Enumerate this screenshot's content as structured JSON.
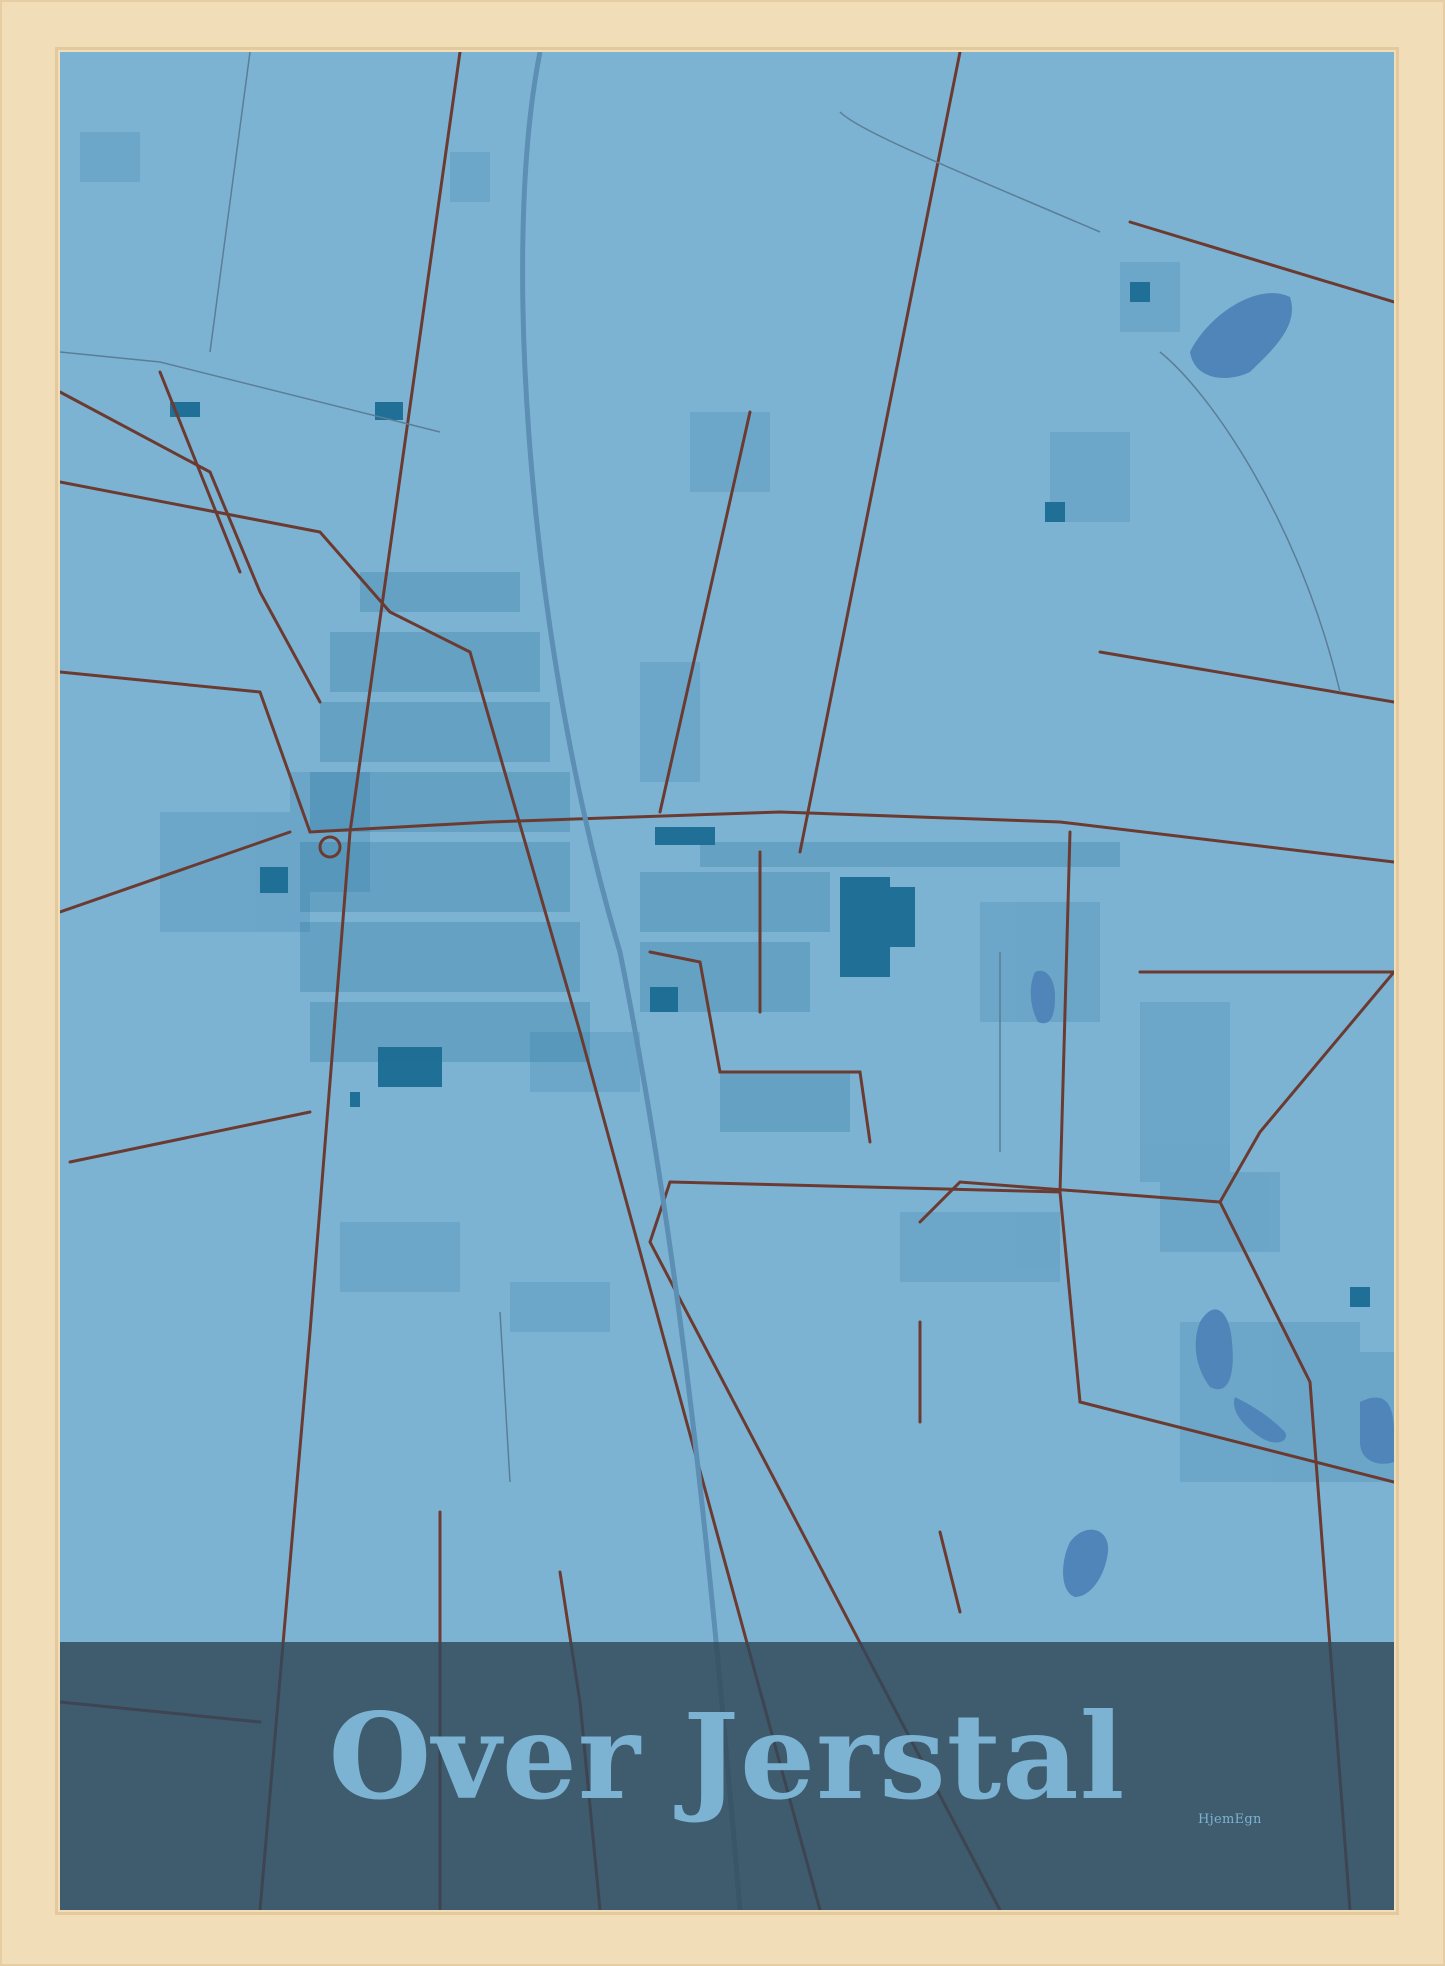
{
  "poster": {
    "title": "Over Jerstal",
    "brand": "HjemEgn"
  },
  "colors": {
    "frame": "#f2ddb9",
    "map_background": "#7db3d2",
    "land_parcel": "#6aa5c8",
    "buildings": "#1f6f96",
    "roads": "#6b3b32",
    "lakes": "#4f85b8",
    "title_band": "#3a5568",
    "title_text": "#7db3d2"
  }
}
